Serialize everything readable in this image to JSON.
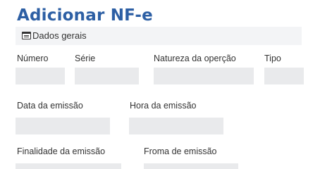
{
  "form": {
    "title": "Adicionar NF-e",
    "section": {
      "icon": "list-card-icon",
      "label": "Dados gerais"
    },
    "fields": {
      "numero": {
        "label": "Número",
        "value": ""
      },
      "serie": {
        "label": "Série",
        "value": ""
      },
      "natureza": {
        "label": "Natureza da operção",
        "value": ""
      },
      "tipo": {
        "label": "Tipo",
        "value": ""
      },
      "data_emissao": {
        "label": "Data da emissão",
        "value": ""
      },
      "hora_emissao": {
        "label": "Hora da emissão",
        "value": ""
      },
      "finalidade": {
        "label": "Finalidade da emissão",
        "value": ""
      },
      "forma_emissao": {
        "label": "Froma de emissão",
        "value": ""
      }
    }
  },
  "colors": {
    "title": "#2d5fa4",
    "section_bg": "#f3f4f6",
    "field_bg": "#e9eaec",
    "text": "#333333"
  }
}
